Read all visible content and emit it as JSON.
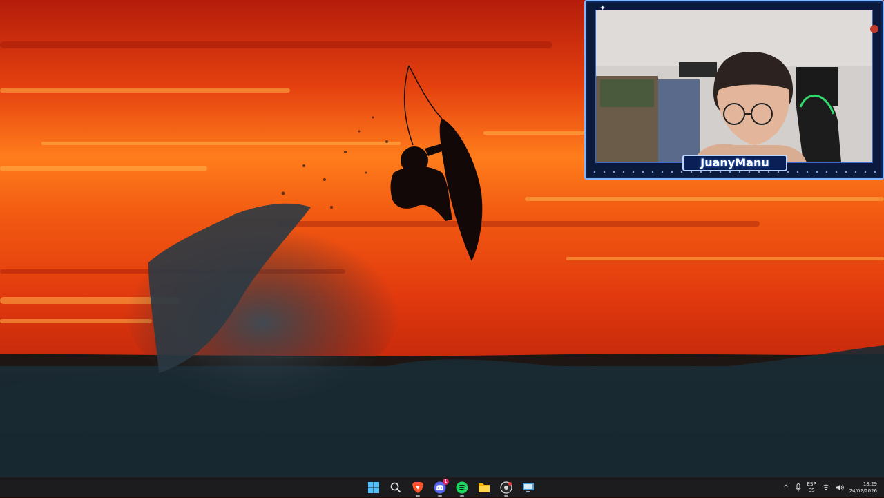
{
  "webcam": {
    "streamer_name": "JuanyManu"
  },
  "taskbar": {
    "pinned": [
      {
        "name": "start-icon"
      },
      {
        "name": "search-icon"
      },
      {
        "name": "brave-browser-icon"
      },
      {
        "name": "discord-icon",
        "badge": "1"
      },
      {
        "name": "spotify-icon"
      },
      {
        "name": "file-explorer-icon"
      },
      {
        "name": "recorder-icon"
      },
      {
        "name": "remote-desktop-icon"
      }
    ],
    "tray": {
      "language_top": "ESP",
      "language_bottom": "ES",
      "time": "18:29",
      "date": "24/02/2026"
    }
  },
  "colors": {
    "taskbar_bg": "#1c1c1e",
    "webcam_frame": "#7fb4ff",
    "sky_orange": "#ff6a1a",
    "sky_red": "#d8250c"
  }
}
